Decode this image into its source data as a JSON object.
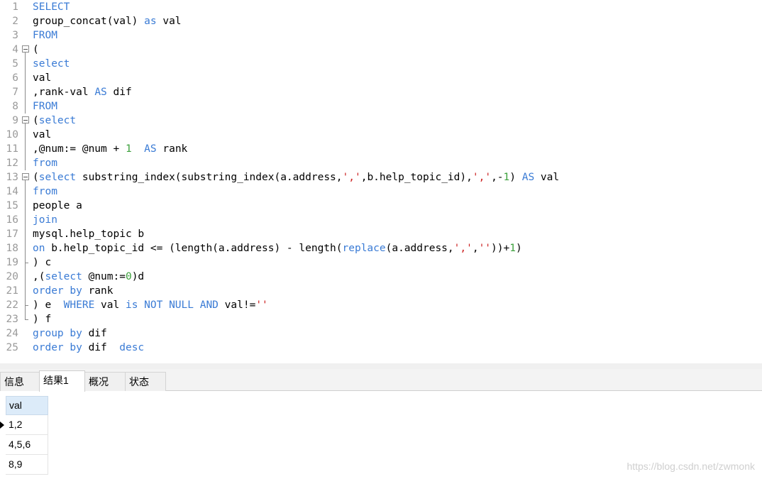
{
  "editor": {
    "lines": [
      {
        "n": "1",
        "fold": "",
        "tokens": [
          {
            "t": "kw",
            "v": "SELECT"
          }
        ]
      },
      {
        "n": "2",
        "fold": "",
        "tokens": [
          {
            "t": "tx",
            "v": "group_concat(val) "
          },
          {
            "t": "kw",
            "v": "as"
          },
          {
            "t": "tx",
            "v": " val"
          }
        ]
      },
      {
        "n": "3",
        "fold": "",
        "tokens": [
          {
            "t": "kw",
            "v": "FROM"
          }
        ]
      },
      {
        "n": "4",
        "fold": "start",
        "tokens": [
          {
            "t": "tx",
            "v": "("
          }
        ]
      },
      {
        "n": "5",
        "fold": "line",
        "tokens": [
          {
            "t": "kw",
            "v": "select"
          }
        ]
      },
      {
        "n": "6",
        "fold": "line",
        "tokens": [
          {
            "t": "tx",
            "v": "val"
          }
        ]
      },
      {
        "n": "7",
        "fold": "line",
        "tokens": [
          {
            "t": "tx",
            "v": ",rank-val "
          },
          {
            "t": "kw",
            "v": "AS"
          },
          {
            "t": "tx",
            "v": " dif"
          }
        ]
      },
      {
        "n": "8",
        "fold": "line",
        "tokens": [
          {
            "t": "kw",
            "v": "FROM"
          }
        ]
      },
      {
        "n": "9",
        "fold": "start",
        "tokens": [
          {
            "t": "tx",
            "v": "("
          },
          {
            "t": "kw",
            "v": "select"
          }
        ]
      },
      {
        "n": "10",
        "fold": "line",
        "tokens": [
          {
            "t": "tx",
            "v": "val"
          }
        ]
      },
      {
        "n": "11",
        "fold": "line",
        "tokens": [
          {
            "t": "tx",
            "v": ",@num:= @num + "
          },
          {
            "t": "num",
            "v": "1"
          },
          {
            "t": "tx",
            "v": "  "
          },
          {
            "t": "kw",
            "v": "AS"
          },
          {
            "t": "tx",
            "v": " rank"
          }
        ]
      },
      {
        "n": "12",
        "fold": "line",
        "tokens": [
          {
            "t": "kw",
            "v": "from"
          }
        ]
      },
      {
        "n": "13",
        "fold": "start",
        "tokens": [
          {
            "t": "tx",
            "v": "("
          },
          {
            "t": "kw",
            "v": "select"
          },
          {
            "t": "tx",
            "v": " substring_index(substring_index(a.address,"
          },
          {
            "t": "str",
            "v": "','"
          },
          {
            "t": "tx",
            "v": ",b.help_topic_id),"
          },
          {
            "t": "str",
            "v": "','"
          },
          {
            "t": "tx",
            "v": ",-"
          },
          {
            "t": "num",
            "v": "1"
          },
          {
            "t": "tx",
            "v": ") "
          },
          {
            "t": "kw",
            "v": "AS"
          },
          {
            "t": "tx",
            "v": " val"
          }
        ]
      },
      {
        "n": "14",
        "fold": "line",
        "tokens": [
          {
            "t": "kw",
            "v": "from"
          }
        ]
      },
      {
        "n": "15",
        "fold": "line",
        "tokens": [
          {
            "t": "tx",
            "v": "people a"
          }
        ]
      },
      {
        "n": "16",
        "fold": "line",
        "tokens": [
          {
            "t": "kw",
            "v": "join"
          }
        ]
      },
      {
        "n": "17",
        "fold": "line",
        "tokens": [
          {
            "t": "tx",
            "v": "mysql.help_topic b"
          }
        ]
      },
      {
        "n": "18",
        "fold": "line",
        "tokens": [
          {
            "t": "kw",
            "v": "on"
          },
          {
            "t": "tx",
            "v": " b.help_topic_id <= (length(a.address) - length("
          },
          {
            "t": "kw",
            "v": "replace"
          },
          {
            "t": "tx",
            "v": "(a.address,"
          },
          {
            "t": "str",
            "v": "','"
          },
          {
            "t": "tx",
            "v": ","
          },
          {
            "t": "str",
            "v": "''"
          },
          {
            "t": "tx",
            "v": "))+"
          },
          {
            "t": "num",
            "v": "1"
          },
          {
            "t": "tx",
            "v": ")"
          }
        ]
      },
      {
        "n": "19",
        "fold": "tick",
        "tokens": [
          {
            "t": "tx",
            "v": ") c"
          }
        ]
      },
      {
        "n": "20",
        "fold": "line",
        "tokens": [
          {
            "t": "tx",
            "v": ",("
          },
          {
            "t": "kw",
            "v": "select"
          },
          {
            "t": "tx",
            "v": " @num:="
          },
          {
            "t": "num",
            "v": "0"
          },
          {
            "t": "tx",
            "v": ")d"
          }
        ]
      },
      {
        "n": "21",
        "fold": "line",
        "tokens": [
          {
            "t": "kw",
            "v": "order by"
          },
          {
            "t": "tx",
            "v": " rank"
          }
        ]
      },
      {
        "n": "22",
        "fold": "tick",
        "tokens": [
          {
            "t": "tx",
            "v": ") e  "
          },
          {
            "t": "kw",
            "v": "WHERE"
          },
          {
            "t": "tx",
            "v": " val "
          },
          {
            "t": "kw",
            "v": "is NOT NULL AND"
          },
          {
            "t": "tx",
            "v": " val!="
          },
          {
            "t": "str",
            "v": "''"
          }
        ]
      },
      {
        "n": "23",
        "fold": "end",
        "tokens": [
          {
            "t": "tx",
            "v": ") f"
          }
        ]
      },
      {
        "n": "24",
        "fold": "",
        "tokens": [
          {
            "t": "kw",
            "v": "group by"
          },
          {
            "t": "tx",
            "v": " dif"
          }
        ]
      },
      {
        "n": "25",
        "fold": "",
        "tokens": [
          {
            "t": "kw",
            "v": "order by"
          },
          {
            "t": "tx",
            "v": " dif  "
          },
          {
            "t": "kw",
            "v": "desc"
          }
        ]
      }
    ]
  },
  "tabs": [
    {
      "label": "信息",
      "active": false
    },
    {
      "label": "结果1",
      "active": true
    },
    {
      "label": "概况",
      "active": false
    },
    {
      "label": "状态",
      "active": false
    }
  ],
  "results": {
    "column": "val",
    "rows": [
      "1,2",
      "4,5,6",
      "8,9"
    ],
    "current_row": 0
  },
  "watermark": "https://blog.csdn.net/zwmonk",
  "colors": {
    "keyword": "#3a7bd5",
    "string": "#cc2222",
    "number": "#3ca03c",
    "header_bg": "#dcebf9"
  }
}
